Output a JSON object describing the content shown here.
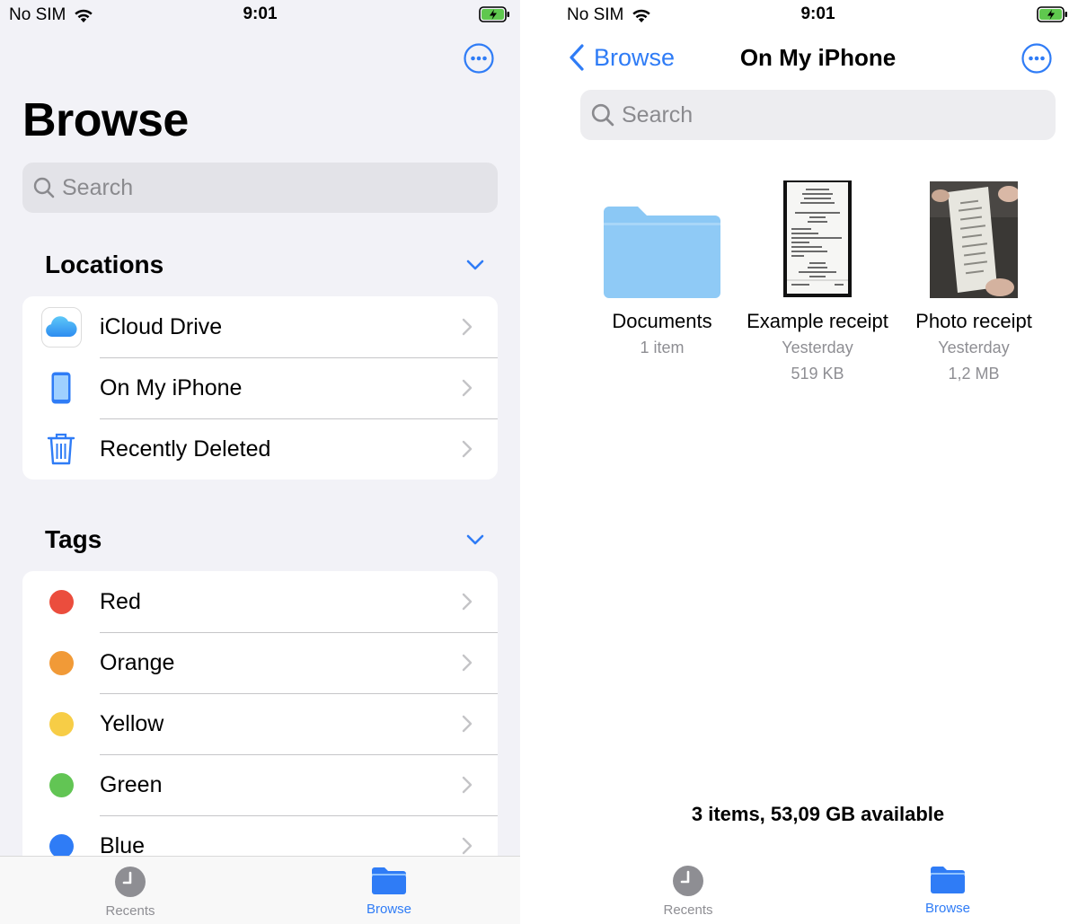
{
  "status": {
    "carrier": "No SIM",
    "time": "9:01"
  },
  "colors": {
    "accent": "#2f7cf6",
    "red": "#eb4d3d",
    "orange": "#f19a37",
    "yellow": "#f7cd46",
    "green": "#62c554",
    "blue": "#2f7cf6"
  },
  "left": {
    "title": "Browse",
    "search_placeholder": "Search",
    "locations_heading": "Locations",
    "locations": [
      {
        "label": "iCloud Drive",
        "icon": "icloud-icon"
      },
      {
        "label": "On My iPhone",
        "icon": "iphone-icon"
      },
      {
        "label": "Recently Deleted",
        "icon": "trash-icon"
      }
    ],
    "tags_heading": "Tags",
    "tags": [
      {
        "label": "Red",
        "color": "#eb4d3d"
      },
      {
        "label": "Orange",
        "color": "#f19a37"
      },
      {
        "label": "Yellow",
        "color": "#f7cd46"
      },
      {
        "label": "Green",
        "color": "#62c554"
      },
      {
        "label": "Blue",
        "color": "#2f7cf6"
      }
    ]
  },
  "right": {
    "back_label": "Browse",
    "title": "On My iPhone",
    "search_placeholder": "Search",
    "files": [
      {
        "name": "Documents",
        "meta1": "1 item",
        "meta2": "",
        "kind": "folder"
      },
      {
        "name": "Example receipt",
        "meta1": "Yesterday",
        "meta2": "519 KB",
        "kind": "document"
      },
      {
        "name": "Photo receipt",
        "meta1": "Yesterday",
        "meta2": "1,2 MB",
        "kind": "photo"
      }
    ],
    "summary": "3 items, 53,09 GB available"
  },
  "tabbar": {
    "recents": "Recents",
    "browse": "Browse"
  }
}
